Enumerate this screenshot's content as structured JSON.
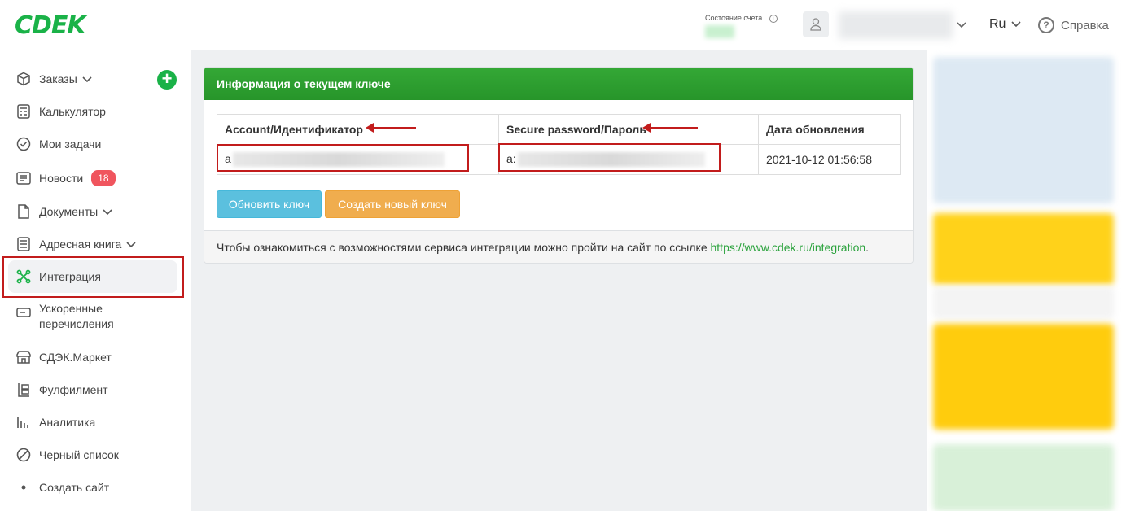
{
  "logo": "CDEK",
  "colors": {
    "brand_green": "#1ab248",
    "highlight_red": "#c21c1c",
    "blue_button": "#5bc0de",
    "orange_button": "#f0ad4e"
  },
  "sidebar": {
    "add_button": "+",
    "items": [
      {
        "label": "Заказы",
        "icon": "box-icon",
        "dropdown": true
      },
      {
        "label": "Калькулятор",
        "icon": "calculator-icon"
      },
      {
        "label": "Мои задачи",
        "icon": "check-circle-icon"
      },
      {
        "label": "Новости",
        "icon": "news-icon",
        "badge": "18"
      },
      {
        "label": "Документы",
        "icon": "document-icon",
        "dropdown": true
      },
      {
        "label": "Адресная книга",
        "icon": "address-book-icon",
        "dropdown": true
      },
      {
        "label": "Интеграция",
        "icon": "integration-icon",
        "active": true
      },
      {
        "label": "Ускоренные перечисления",
        "icon": "transfer-icon"
      },
      {
        "label": "СДЭК.Маркет",
        "icon": "store-icon"
      },
      {
        "label": "Фулфилмент",
        "icon": "fulfillment-icon"
      },
      {
        "label": "Аналитика",
        "icon": "analytics-icon"
      },
      {
        "label": "Черный список",
        "icon": "blocked-icon"
      },
      {
        "label": "Создать сайт",
        "icon": "dot-icon"
      }
    ]
  },
  "header": {
    "account_status_label": "Состояние счета",
    "language": "Ru",
    "help": "Справка"
  },
  "key_panel": {
    "title": "Информация о текущем ключе",
    "columns": [
      "Account/Идентификатор",
      "Secure password/Пароль",
      "Дата обновления"
    ],
    "account_prefix": "a",
    "password_prefix": "a:",
    "updated": "2021-10-12 01:56:58",
    "refresh_button": "Обновить ключ",
    "new_key_button": "Создать новый ключ",
    "footer_text": "Чтобы ознакомиться с возможностями сервиса интеграции можно пройти на сайт по ссылке ",
    "footer_link": "https://www.cdek.ru/integration",
    "footer_end": "."
  }
}
